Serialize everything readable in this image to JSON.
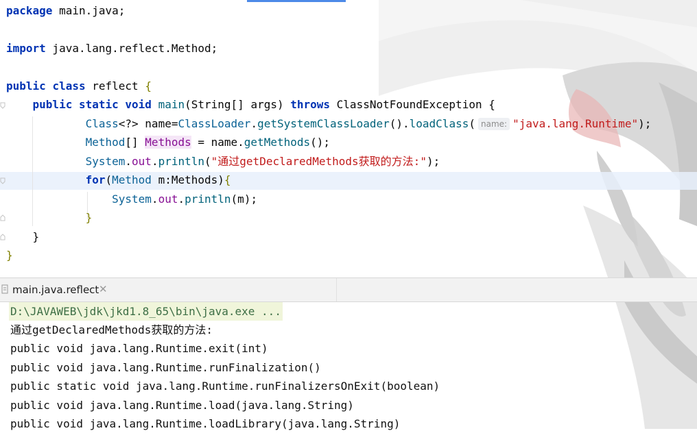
{
  "editor": {
    "lines": [
      {
        "segments": [
          {
            "t": "package",
            "c": "kw"
          },
          {
            "t": " main.java;",
            "c": ""
          }
        ]
      },
      {
        "segments": []
      },
      {
        "segments": [
          {
            "t": "import",
            "c": "kw"
          },
          {
            "t": " java.lang.reflect.Method;",
            "c": ""
          }
        ]
      },
      {
        "segments": []
      },
      {
        "segments": [
          {
            "t": "public",
            "c": "kw"
          },
          {
            "t": " ",
            "c": ""
          },
          {
            "t": "class",
            "c": "kw"
          },
          {
            "t": " reflect ",
            "c": ""
          },
          {
            "t": "{",
            "c": "brace"
          }
        ]
      },
      {
        "segments": [
          {
            "t": "    ",
            "c": ""
          },
          {
            "t": "public",
            "c": "kw"
          },
          {
            "t": " ",
            "c": ""
          },
          {
            "t": "static",
            "c": "kw"
          },
          {
            "t": " ",
            "c": ""
          },
          {
            "t": "void",
            "c": "kw"
          },
          {
            "t": " ",
            "c": ""
          },
          {
            "t": "main",
            "c": "cls"
          },
          {
            "t": "(String[] args) ",
            "c": ""
          },
          {
            "t": "throws",
            "c": "kw"
          },
          {
            "t": " ClassNotFoundException {",
            "c": ""
          }
        ]
      },
      {
        "segments": [
          {
            "t": "            ",
            "c": ""
          },
          {
            "t": "Class",
            "c": "type"
          },
          {
            "t": "<?> name=",
            "c": ""
          },
          {
            "t": "ClassLoader",
            "c": "type"
          },
          {
            "t": ".",
            "c": ""
          },
          {
            "t": "getSystemClassLoader",
            "c": "cls"
          },
          {
            "t": "().",
            "c": ""
          },
          {
            "t": "loadClass",
            "c": "cls"
          },
          {
            "t": "(",
            "c": ""
          },
          {
            "t": "name:",
            "c": "hint"
          },
          {
            "t": "\"java.lang.Runtime\"",
            "c": "str-red"
          },
          {
            "t": ");",
            "c": ""
          }
        ]
      },
      {
        "segments": [
          {
            "t": "            ",
            "c": ""
          },
          {
            "t": "Method",
            "c": "type"
          },
          {
            "t": "[] ",
            "c": ""
          },
          {
            "t": "Methods",
            "c": "var-hl"
          },
          {
            "t": " = name.",
            "c": ""
          },
          {
            "t": "getMethods",
            "c": "cls"
          },
          {
            "t": "();",
            "c": ""
          }
        ]
      },
      {
        "segments": [
          {
            "t": "            ",
            "c": ""
          },
          {
            "t": "System",
            "c": "type"
          },
          {
            "t": ".",
            "c": ""
          },
          {
            "t": "out",
            "c": "fld"
          },
          {
            "t": ".",
            "c": ""
          },
          {
            "t": "println",
            "c": "cls"
          },
          {
            "t": "(",
            "c": ""
          },
          {
            "t": "\"通过getDeclaredMethods获取的方法:\"",
            "c": "str-red"
          },
          {
            "t": ");",
            "c": ""
          }
        ]
      },
      {
        "segments": [
          {
            "t": "            ",
            "c": ""
          },
          {
            "t": "for",
            "c": "kw"
          },
          {
            "t": "(",
            "c": ""
          },
          {
            "t": "Method",
            "c": "type"
          },
          {
            "t": " m:Methods)",
            "c": ""
          },
          {
            "t": "{",
            "c": "brace"
          }
        ]
      },
      {
        "segments": [
          {
            "t": "                ",
            "c": ""
          },
          {
            "t": "System",
            "c": "type"
          },
          {
            "t": ".",
            "c": ""
          },
          {
            "t": "out",
            "c": "fld"
          },
          {
            "t": ".",
            "c": ""
          },
          {
            "t": "println",
            "c": "cls"
          },
          {
            "t": "(m);",
            "c": ""
          }
        ]
      },
      {
        "segments": [
          {
            "t": "            ",
            "c": ""
          },
          {
            "t": "}",
            "c": "brace"
          }
        ]
      },
      {
        "segments": [
          {
            "t": "    }",
            "c": ""
          }
        ]
      },
      {
        "segments": [
          {
            "t": "}",
            "c": "brace"
          }
        ]
      }
    ]
  },
  "run_panel": {
    "tab_label": "main.java.reflect",
    "close_glyph": "✕"
  },
  "console": {
    "lines": [
      "D:\\JAVAWEB\\jdk\\jkd1.8_65\\bin\\java.exe ...",
      "通过getDeclaredMethods获取的方法:",
      "public void java.lang.Runtime.exit(int)",
      "public void java.lang.Runtime.runFinalization()",
      "public static void java.lang.Runtime.runFinalizersOnExit(boolean)",
      "public void java.lang.Runtime.load(java.lang.String)",
      "public void java.lang.Runtime.loadLibrary(java.lang.String)"
    ]
  },
  "colors": {
    "keyword": "#0033b3",
    "string": "#c11b1b",
    "brace": "#808000",
    "console_cmd": "#3d6e45"
  }
}
